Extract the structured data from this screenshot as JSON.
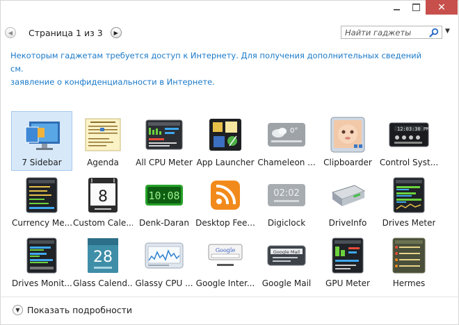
{
  "toolbar": {
    "page_label": "Страница 1 из 3",
    "search_placeholder": "Найти гаджеты"
  },
  "info": {
    "line1": "Некоторым гаджетам требуется доступ к Интернету. Для получения дополнительных сведений см.",
    "line2": "заявление о конфиденциальности в Интернете."
  },
  "gadgets": [
    {
      "label": "7 Sidebar",
      "icon": "monitor-sidebar-icon",
      "selected": true
    },
    {
      "label": "Agenda",
      "icon": "calendar-agenda-icon"
    },
    {
      "label": "All CPU Meter",
      "icon": "cpu-meter-icon"
    },
    {
      "label": "App Launcher",
      "icon": "app-launcher-icon"
    },
    {
      "label": "Chameleon ...",
      "icon": "weather-icon"
    },
    {
      "label": "Clipboarder",
      "icon": "baby-photo-icon"
    },
    {
      "label": "Control Syst...",
      "icon": "clock-control-icon"
    },
    {
      "label": "Currency Me...",
      "icon": "currency-meter-icon"
    },
    {
      "label": "Custom Cale...",
      "icon": "custom-calendar-icon"
    },
    {
      "label": "Denk-Daran",
      "icon": "green-digital-clock-icon"
    },
    {
      "label": "Desktop Fee...",
      "icon": "rss-feed-icon"
    },
    {
      "label": "Digiclock",
      "icon": "digiclock-icon"
    },
    {
      "label": "DriveInfo",
      "icon": "drive-icon"
    },
    {
      "label": "Drives Meter",
      "icon": "drives-meter-icon"
    },
    {
      "label": "Drives Monit...",
      "icon": "drives-monitor-icon"
    },
    {
      "label": "Glass Calend...",
      "icon": "glass-calendar-icon"
    },
    {
      "label": "Glassy CPU ...",
      "icon": "cpu-graph-icon"
    },
    {
      "label": "Google Inter...",
      "icon": "google-search-icon"
    },
    {
      "label": "Google Mail",
      "icon": "google-mail-icon"
    },
    {
      "label": "GPU Meter",
      "icon": "gpu-meter-icon"
    },
    {
      "label": "Hermes",
      "icon": "hermes-icon"
    }
  ],
  "footer": {
    "details_label": "Показать подробности"
  },
  "colors": {
    "link_blue": "#1b7ac9",
    "close_red": "#c7504c",
    "selection": "#d7e8f8"
  }
}
